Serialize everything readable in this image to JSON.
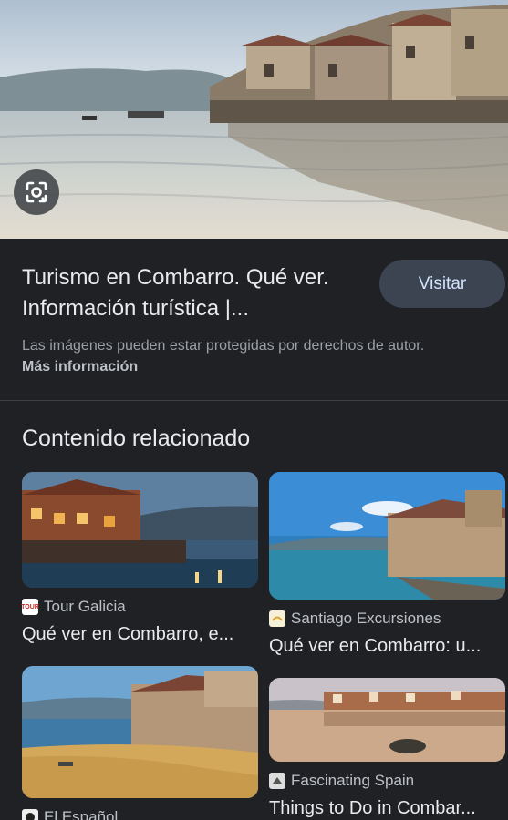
{
  "result": {
    "title": "Turismo en Combarro. Qué ver. Información turística |...",
    "visit_label": "Visitar",
    "copyright_text": "Las imágenes pueden estar protegidas por derechos de autor.",
    "more_info_label": "Más información"
  },
  "related": {
    "heading": "Contenido relacionado",
    "cards": [
      {
        "source": "Tour Galicia",
        "title": "Qué ver en Combarro, e...",
        "favicon": "tour-galicia-favicon",
        "favicon_text": "TOUR"
      },
      {
        "source": "Santiago Excursiones",
        "title": "Qué ver en Combarro: u...",
        "favicon": "santiago-excursiones-favicon"
      },
      {
        "source": "El Español",
        "title": "",
        "favicon": "el-espanol-favicon"
      },
      {
        "source": "Fascinating Spain",
        "title": "Things to Do in Combar...",
        "favicon": "fascinating-spain-favicon"
      }
    ]
  },
  "icons": {
    "lens": "google-lens-icon"
  },
  "colors": {
    "background": "#202124",
    "visit_button": "#3c4452",
    "visit_text": "#d2e3fc"
  }
}
